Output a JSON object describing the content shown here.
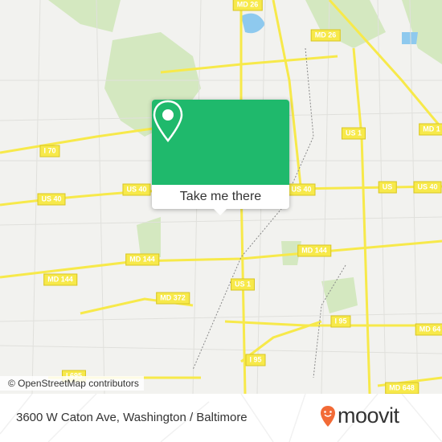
{
  "map": {
    "road_labels": [
      {
        "text": "MD 26"
      },
      {
        "text": "MD 26"
      },
      {
        "text": "I 70"
      },
      {
        "text": "US 40"
      },
      {
        "text": "US 40"
      },
      {
        "text": "US 40"
      },
      {
        "text": "US 1"
      },
      {
        "text": "MD 1"
      },
      {
        "text": "US"
      },
      {
        "text": "US 40"
      },
      {
        "text": "MD 144"
      },
      {
        "text": "MD 144"
      },
      {
        "text": "MD 144"
      },
      {
        "text": "US 1"
      },
      {
        "text": "I 95"
      },
      {
        "text": "MD 64"
      },
      {
        "text": "MD 372"
      },
      {
        "text": "I 95"
      },
      {
        "text": "I 695"
      },
      {
        "text": "MD 648"
      }
    ],
    "attribution": "© OpenStreetMap contributors",
    "colors": {
      "background": "#f2f2ef",
      "park": "#cfe6b8",
      "road": "#f7e94a",
      "water": "#8ec9ee"
    }
  },
  "popup": {
    "icon": "map-pin-icon",
    "button_label": "Take me there",
    "color": "#1fb96c"
  },
  "footer": {
    "address": "3600 W Caton Ave, Washington / Baltimore",
    "logo_text": "moovit",
    "logo_color": "#f26a36"
  }
}
